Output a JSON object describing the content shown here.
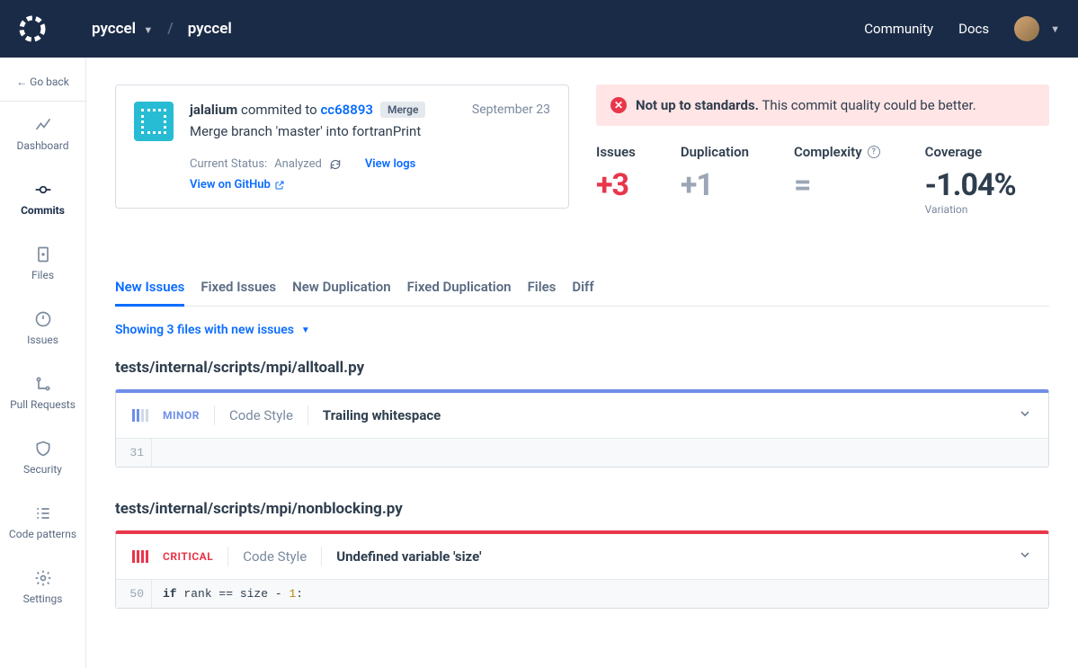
{
  "header": {
    "org": "pyccel",
    "repo": "pyccel",
    "links": {
      "community": "Community",
      "docs": "Docs"
    }
  },
  "sidebar": {
    "goback": "← Go back",
    "items": [
      {
        "label": "Dashboard"
      },
      {
        "label": "Commits"
      },
      {
        "label": "Files"
      },
      {
        "label": "Issues"
      },
      {
        "label": "Pull Requests"
      },
      {
        "label": "Security"
      },
      {
        "label": "Code patterns"
      },
      {
        "label": "Settings"
      }
    ]
  },
  "commit": {
    "author": "jalalium",
    "committed_to": "commited to",
    "hash": "cc68893",
    "merge_badge": "Merge",
    "date": "September 23",
    "message": "Merge branch 'master' into fortranPrint",
    "status_label": "Current Status:",
    "status_value": "Analyzed",
    "view_logs": "View logs",
    "view_github": "View on GitHub"
  },
  "alert": {
    "title": "Not up to standards.",
    "body": "This commit quality could be better."
  },
  "metrics": {
    "issues": {
      "label": "Issues",
      "value": "+3"
    },
    "duplication": {
      "label": "Duplication",
      "value": "+1"
    },
    "complexity": {
      "label": "Complexity",
      "value": "="
    },
    "coverage": {
      "label": "Coverage",
      "value": "-1.04%",
      "sub": "Variation"
    }
  },
  "tabs": [
    "New Issues",
    "Fixed Issues",
    "New Duplication",
    "Fixed Duplication",
    "Files",
    "Diff"
  ],
  "filter": "Showing 3 files with new issues",
  "files": [
    {
      "path": "tests/internal/scripts/mpi/alltoall.py",
      "severity": "MINOR",
      "category": "Code Style",
      "desc": "Trailing whitespace",
      "line": "31",
      "code": ""
    },
    {
      "path": "tests/internal/scripts/mpi/nonblocking.py",
      "severity": "CRITICAL",
      "category": "Code Style",
      "desc": "Undefined variable 'size'",
      "line": "50",
      "code_prefix": "if",
      "code_mid": " rank == size - ",
      "code_num": "1",
      "code_suffix": ":"
    }
  ]
}
